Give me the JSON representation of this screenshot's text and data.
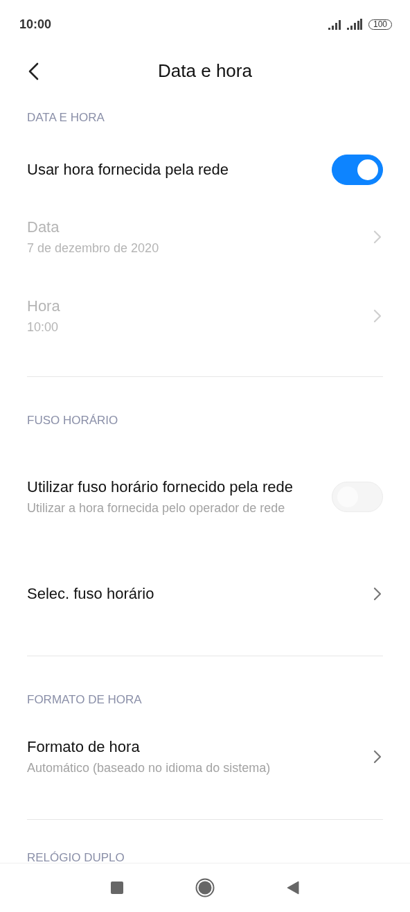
{
  "status_bar": {
    "time": "10:00",
    "battery": "100"
  },
  "header": {
    "title": "Data e hora"
  },
  "sections": [
    {
      "header": "DATA E HORA",
      "items": [
        {
          "kind": "toggle",
          "title": "Usar hora fornecida pela rede",
          "on": true,
          "disabled": false
        },
        {
          "kind": "link",
          "title": "Data",
          "subtitle": "7 de dezembro de 2020",
          "disabled": true
        },
        {
          "kind": "link",
          "title": "Hora",
          "subtitle": "10:00",
          "disabled": true
        }
      ]
    },
    {
      "header": "FUSO HORÁRIO",
      "items": [
        {
          "kind": "toggle",
          "title": "Utilizar fuso horário fornecido pela rede",
          "subtitle": "Utilizar a hora fornecida pelo operador de rede",
          "on": false,
          "disabled": false
        },
        {
          "kind": "link",
          "title": "Selec. fuso horário",
          "disabled": false
        }
      ]
    },
    {
      "header": "FORMATO DE HORA",
      "items": [
        {
          "kind": "link",
          "title": "Formato de hora",
          "subtitle": "Automático (baseado no idioma do sistema)",
          "disabled": false
        }
      ]
    },
    {
      "header": "RELÓGIO DUPLO"
    }
  ]
}
